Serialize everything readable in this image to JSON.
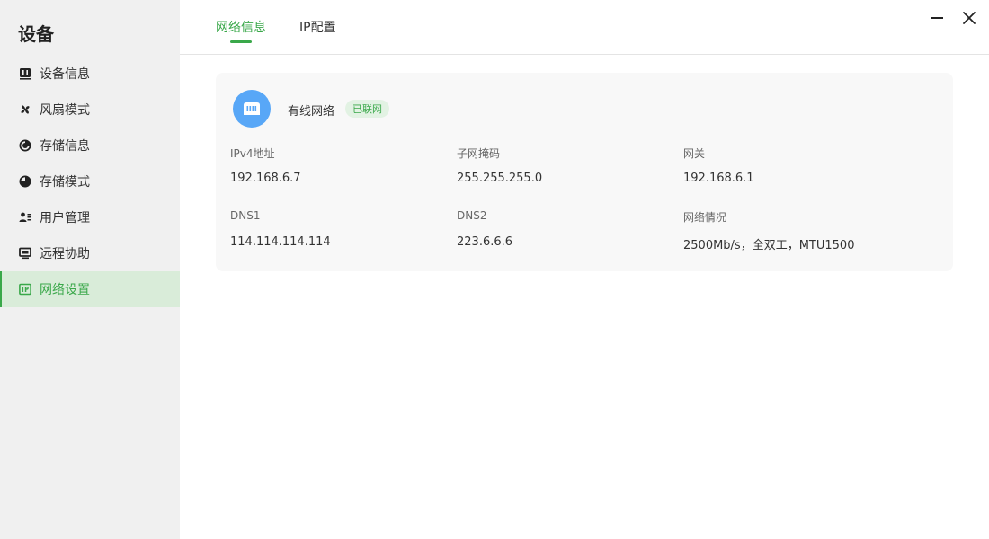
{
  "sidebar": {
    "title": "设备",
    "items": [
      {
        "label": "设备信息",
        "icon": "device-icon"
      },
      {
        "label": "风扇模式",
        "icon": "fan-icon"
      },
      {
        "label": "存储信息",
        "icon": "storage-info-icon"
      },
      {
        "label": "存储模式",
        "icon": "storage-mode-icon"
      },
      {
        "label": "用户管理",
        "icon": "users-icon"
      },
      {
        "label": "远程协助",
        "icon": "monitor-icon"
      },
      {
        "label": "网络设置",
        "icon": "ip-icon",
        "active": true
      }
    ]
  },
  "header": {
    "tabs": [
      {
        "label": "网络信息",
        "active": true
      },
      {
        "label": "IP配置",
        "active": false
      }
    ]
  },
  "network": {
    "name": "有线网络",
    "status": "已联网",
    "fields": [
      {
        "label": "IPv4地址",
        "value": "192.168.6.7"
      },
      {
        "label": "子网掩码",
        "value": "255.255.255.0"
      },
      {
        "label": "网关",
        "value": "192.168.6.1"
      },
      {
        "label": "DNS1",
        "value": "114.114.114.114"
      },
      {
        "label": "DNS2",
        "value": "223.6.6.6"
      },
      {
        "label": "网络情况",
        "value": "2500Mb/s，全双工，MTU1500"
      }
    ]
  },
  "colors": {
    "accent": "#3aa84a",
    "active_bg": "#d9ecd9",
    "sidebar_bg": "#f0f0f0",
    "card_bg": "#f8f8f8",
    "icon_blue": "#58a7f7"
  }
}
